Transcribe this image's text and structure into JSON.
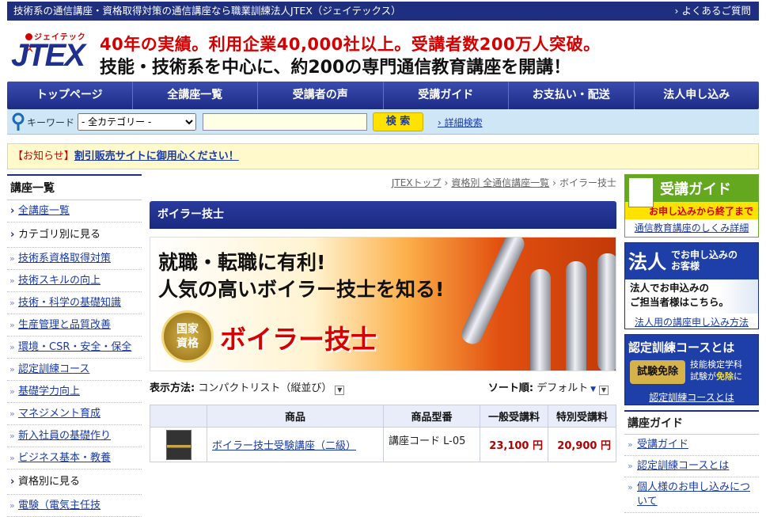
{
  "header": {
    "topline": "技術系の通信講座・資格取得対策の通信講座なら職業訓練法人JTEX（ジェイテックス）",
    "faq_link": "よくあるご質問",
    "logo_kana": "ジェイテックス",
    "logo_word": "JTEX",
    "tagline1": "40年の実績。利用企業40,000社以上。受講者数200万人突破。",
    "tagline2": "技能・技術系を中心に、約200の専門通信教育講座を開講！"
  },
  "nav": [
    "トップページ",
    "全講座一覧",
    "受講者の声",
    "受講ガイド",
    "お支払い・配送",
    "法人申し込み"
  ],
  "search": {
    "keyword_label": "キーワード",
    "category_selected": "- 全カテゴリー -",
    "input_value": "",
    "button": "検 索",
    "advanced": "詳細検索"
  },
  "notice": {
    "label": "【お知らせ】",
    "link": "割引販売サイトに御用心ください！"
  },
  "left": {
    "heading": "講座一覧",
    "all": "全講座一覧",
    "by_category": "カテゴリ別に見る",
    "categories": [
      "技術系資格取得対策",
      "技術スキルの向上",
      "技術・科学の基礎知識",
      "生産管理と品質改善",
      "環境・CSR・安全・保全",
      "認定訓練コース",
      "基礎学力向上",
      "マネジメント育成",
      "新入社員の基礎作り",
      "ビジネス基本・教養"
    ],
    "by_qualification": "資格別に見る",
    "partial": "電験（電気主任技"
  },
  "breadcrumb": {
    "items": [
      "JTEXトップ",
      "資格別 全通信講座一覧",
      "ボイラー技士"
    ]
  },
  "page_title": "ボイラー技士",
  "banner": {
    "line1": "就職・転職に有利!",
    "line2": "人気の高いボイラー技士を知る!",
    "seal_line1": "国家",
    "seal_line2": "資格",
    "big": "ボイラー技士"
  },
  "display": {
    "label": "表示方法:",
    "value": "コンパクトリスト（縦並び）",
    "sort_label": "ソート順:",
    "sort_value": "デフォルト"
  },
  "table": {
    "headers": [
      "商品",
      "商品型番",
      "一般受講料",
      "特別受講料"
    ],
    "rows": [
      {
        "name": "ボイラー技士受験講座（二級）",
        "code": "講座コード L-05",
        "general": "23,100 円",
        "special": "20,900 円"
      }
    ]
  },
  "right": {
    "guide_box": {
      "title": "受講ガイド",
      "sub": "お申し込みから終了まで",
      "link": "通信教育講座のしくみ詳細"
    },
    "corp_box": {
      "big": "法人",
      "small1": "でお申し込みの",
      "small2": "お客様",
      "body1": "法人でお申込みの",
      "body2": "ご担当者様はこちら。",
      "link": "法人用の講座申し込み方法"
    },
    "cert_box": {
      "title": "認定訓練コースとは",
      "badge": "試験免除",
      "t1": "技能検定学科",
      "t2a": "試験が",
      "t2b": "免除",
      "t2c": "に",
      "link": "認定訓練コースとは"
    },
    "guide_list": {
      "heading": "講座ガイド",
      "items": [
        "受講ガイド",
        "認定訓練コースとは",
        "個人様のお申し込みについて"
      ]
    }
  }
}
